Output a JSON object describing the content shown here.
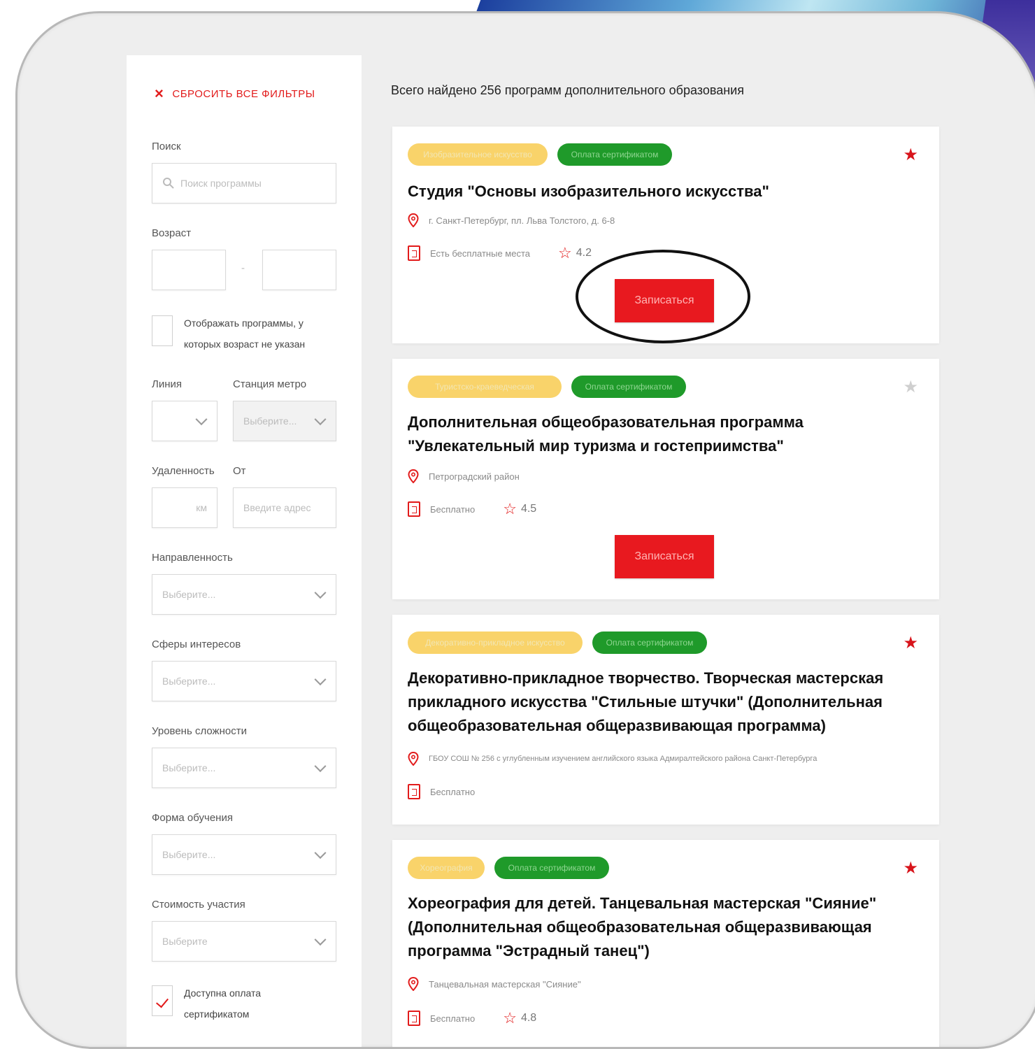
{
  "colors": {
    "accent": "#e8191f",
    "tag_yellow": "#f9d36a",
    "tag_green": "#1f9a2a",
    "panel_bg": "#eeeeee"
  },
  "filters": {
    "reset_label": "СБРОСИТЬ ВСЕ ФИЛЬТРЫ",
    "search_label": "Поиск",
    "search_placeholder": "Поиск программы",
    "age_label": "Возраст",
    "age_separator": "-",
    "show_no_age_label": "Отображать программы, у которых возраст не указан",
    "line_label": "Линия",
    "metro_label": "Станция метро",
    "metro_placeholder": "Выберите...",
    "distance_label": "Удаленность",
    "distance_unit": "км",
    "from_label": "От",
    "from_placeholder": "Введите адрес",
    "direction_label": "Направленность",
    "direction_placeholder": "Выберите...",
    "interests_label": "Сферы интересов",
    "interests_placeholder": "Выберите...",
    "level_label": "Уровень сложности",
    "level_placeholder": "Выберите...",
    "form_label": "Форма обучения",
    "form_placeholder": "Выберите...",
    "cost_label": "Стоимость участия",
    "cost_placeholder": "Выберите",
    "certificate_label": "Доступна оплата сертификатом",
    "certificate_checked": true
  },
  "results": {
    "total_text": "Всего найдено 256 программ дополнительного образования",
    "cards": [
      {
        "tag1": "Изобразительное искусство",
        "tag2": "Оплата сертификатом",
        "title": "Студия \"Основы изобразительного искусства\"",
        "address": "г. Санкт-Петербург, пл. Льва Толстого, д. 6-8",
        "seats": "Есть бесплатные места",
        "rating": "4.2",
        "enroll_label": "Записаться",
        "favorite": true,
        "highlighted": true
      },
      {
        "tag1": "Туристско-краеведческая",
        "tag2": "Оплата сертификатом",
        "title": "Дополнительная общеобразовательная программа \"Увлекательный мир туризма и гостеприимства\"",
        "address": "Петроградский район",
        "seats": "Бесплатно",
        "rating": "4.5",
        "enroll_label": "Записаться",
        "favorite": false
      },
      {
        "tag1": "Декоративно-прикладное искусство",
        "tag2": "Оплата сертификатом",
        "title": "Декоративно-прикладное творчество. Творческая мастерская прикладного искусства \"Стильные штучки\" (Дополнительная общеобразовательная общеразвивающая программа)",
        "address": "ГБОУ СОШ № 256 с углубленным изучением английского языка Адмиралтейского района Санкт-Петербурга",
        "seats": "Бесплатно",
        "favorite": true
      },
      {
        "tag1": "Хореография",
        "tag2": "Оплата сертификатом",
        "title": "Хореография для детей. Танцевальная мастерская \"Сияние\" (Дополнительная общеобразовательная общеразвивающая программа \"Эстрадный танец\")",
        "address": "Танцевальная мастерская \"Сияние\"",
        "seats": "Бесплатно",
        "rating": "4.8",
        "favorite": true
      }
    ]
  }
}
